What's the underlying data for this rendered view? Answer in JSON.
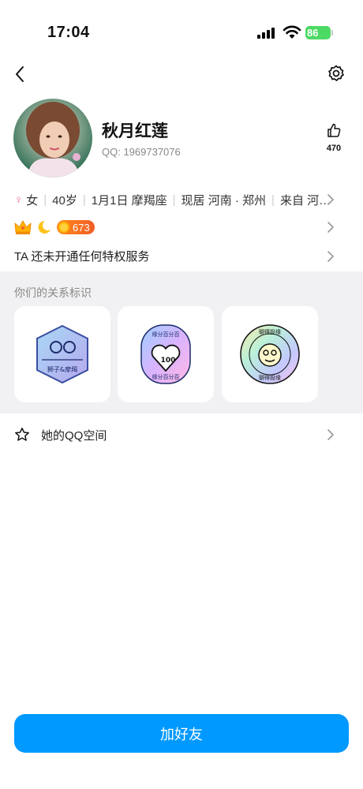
{
  "status_bar": {
    "time": "17:04",
    "battery": "86"
  },
  "profile": {
    "nickname": "秋月红莲",
    "qq_label": "QQ: 1969737076",
    "like_count": "470"
  },
  "info": {
    "gender": "女",
    "age": "40岁",
    "birthday": "1月1日 摩羯座",
    "location": "现居 河南 · 郑州",
    "hometown": "来自 河…"
  },
  "badges": {
    "level": "673"
  },
  "privilege_text": "TA 还未开通任何特权服务",
  "relation": {
    "title": "你们的关系标识",
    "cards": [
      {
        "label": "狮子&摩羯"
      },
      {
        "top_text": "缘分百分百",
        "score": "100",
        "bottom_text": "缘分百分百"
      },
      {
        "top_text": "聊得投缘",
        "bottom_text": "聊得投缘"
      }
    ]
  },
  "qzone_label": "她的QQ空间",
  "add_friend_label": "加好友",
  "colors": {
    "primary": "#0099ff",
    "section_bg": "#f1f1f3",
    "battery": "#4cd964",
    "level_badge": "#f25c25"
  }
}
